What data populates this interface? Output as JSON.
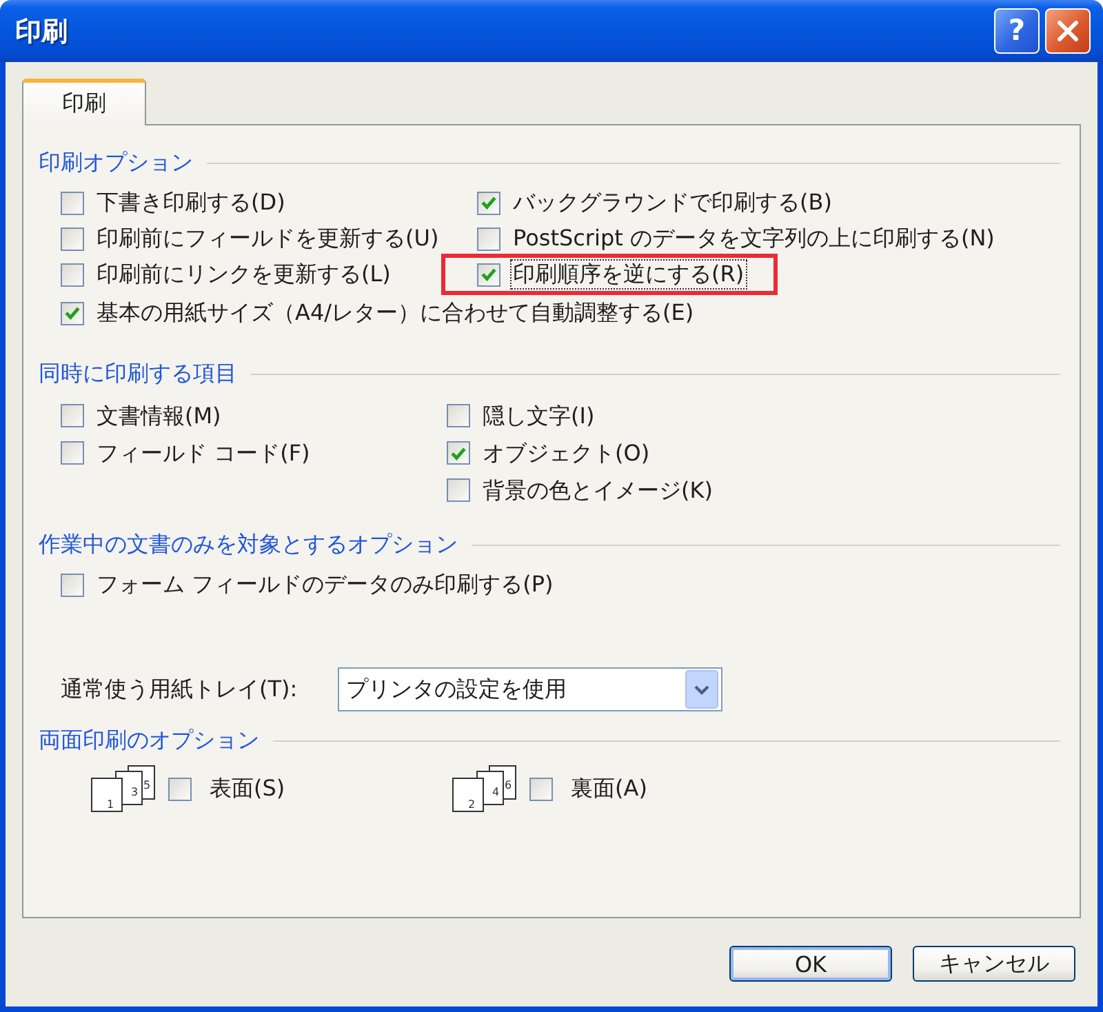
{
  "window": {
    "title": "印刷",
    "help_button": "?"
  },
  "tabs": [
    {
      "label": "印刷",
      "selected": true
    }
  ],
  "print_options": {
    "title": "印刷オプション",
    "column_1": [
      {
        "label": "下書き印刷する(D)",
        "checked": false,
        "focused": false,
        "highlighted": false
      },
      {
        "label": "印刷前にフィールドを更新する(U)",
        "checked": false,
        "focused": false,
        "highlighted": false
      },
      {
        "label": "印刷前にリンクを更新する(L)",
        "checked": false,
        "focused": false,
        "highlighted": false
      }
    ],
    "column_2": [
      {
        "label": "バックグラウンドで印刷する(B)",
        "checked": true,
        "focused": false,
        "highlighted": false
      },
      {
        "label": "PostScript のデータを文字列の上に印刷する(N)",
        "checked": false,
        "focused": false,
        "highlighted": false
      },
      {
        "label": "印刷順序を逆にする(R)",
        "checked": true,
        "focused": true,
        "highlighted": true
      }
    ],
    "wide": [
      {
        "label": "基本の用紙サイズ（A4/レター）に合わせて自動調整する(E)",
        "checked": true,
        "focused": false,
        "highlighted": false
      }
    ]
  },
  "include_items": {
    "title": "同時に印刷する項目",
    "column_1": [
      {
        "label": "文書情報(M)",
        "checked": false
      },
      {
        "label": "フィールド コード(F)",
        "checked": false
      }
    ],
    "column_2": [
      {
        "label": "隠し文字(I)",
        "checked": false
      },
      {
        "label": "オブジェクト(O)",
        "checked": true
      },
      {
        "label": "背景の色とイメージ(K)",
        "checked": false
      }
    ]
  },
  "current_document_options": {
    "title": "作業中の文書のみを対象とするオプション",
    "items": [
      {
        "label": "フォーム フィールドのデータのみ印刷する(P)",
        "checked": false
      }
    ]
  },
  "paper_tray": {
    "label": "通常使う用紙トレイ(T):",
    "value": "プリンタの設定を使用"
  },
  "duplex_options": {
    "title": "両面印刷のオプション",
    "items": [
      {
        "label": "表面(S)",
        "checked": false,
        "page_numbers": [
          "1",
          "3",
          "5"
        ]
      },
      {
        "label": "裏面(A)",
        "checked": false,
        "page_numbers": [
          "2",
          "4",
          "6"
        ]
      }
    ]
  },
  "buttons": [
    {
      "label": "OK",
      "default": true
    },
    {
      "label": "キャンセル",
      "default": false
    }
  ]
}
